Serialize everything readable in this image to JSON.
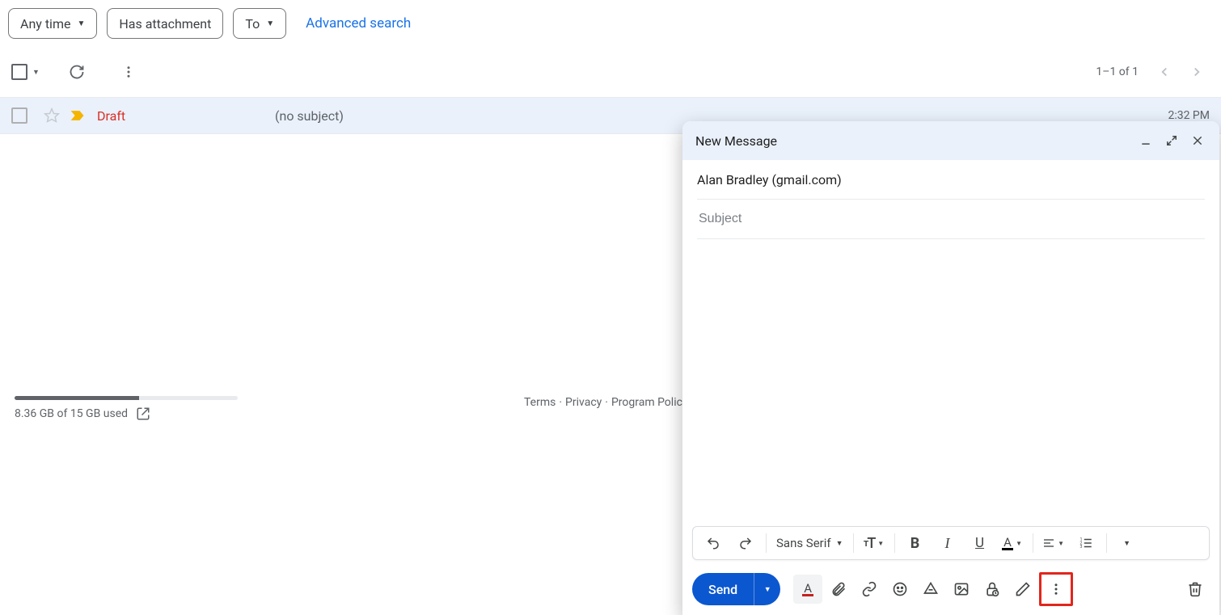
{
  "filters": {
    "anyTime": "Any time",
    "hasAttachment": "Has attachment",
    "to": "To",
    "advanced": "Advanced search"
  },
  "toolbar": {
    "pageCount": "1–1 of 1"
  },
  "mailRow": {
    "sender": "Draft",
    "subject": "(no subject)",
    "time": "2:32 PM"
  },
  "footer": {
    "storageUsed": "8.36 GB of 15 GB used",
    "storagePercent": 55.7,
    "terms": "Terms",
    "privacy": "Privacy",
    "program": "Program Policies"
  },
  "compose": {
    "title": "New Message",
    "recipient": "Alan Bradley (gmail.com)",
    "subjectPlaceholder": "Subject",
    "fontFamily": "Sans Serif",
    "sendLabel": "Send"
  }
}
